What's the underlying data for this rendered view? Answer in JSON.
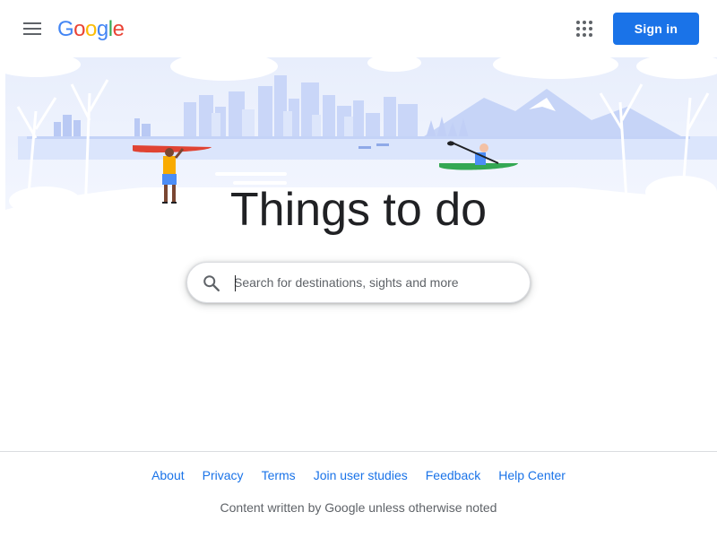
{
  "header": {
    "logo_letters": [
      {
        "char": "G",
        "color": "#4285F4"
      },
      {
        "char": "o",
        "color": "#EA4335"
      },
      {
        "char": "o",
        "color": "#FBBC05"
      },
      {
        "char": "g",
        "color": "#4285F4"
      },
      {
        "char": "l",
        "color": "#34A853"
      },
      {
        "char": "e",
        "color": "#EA4335"
      }
    ],
    "menu_icon": "hamburger-menu-icon",
    "apps_icon": "apps-grid-icon",
    "signin_label": "Sign in"
  },
  "hero": {
    "title": "Things to do",
    "illustration": "city-lake-kayak-illustration"
  },
  "search": {
    "icon": "search-icon",
    "placeholder": "Search for destinations, sights and more",
    "value": ""
  },
  "footer": {
    "links": [
      "About",
      "Privacy",
      "Terms",
      "Join user studies",
      "Feedback",
      "Help Center"
    ],
    "note": "Content written by Google unless otherwise noted"
  },
  "colors": {
    "accent": "#1a73e8",
    "text": "#202124",
    "muted": "#5f6368"
  }
}
